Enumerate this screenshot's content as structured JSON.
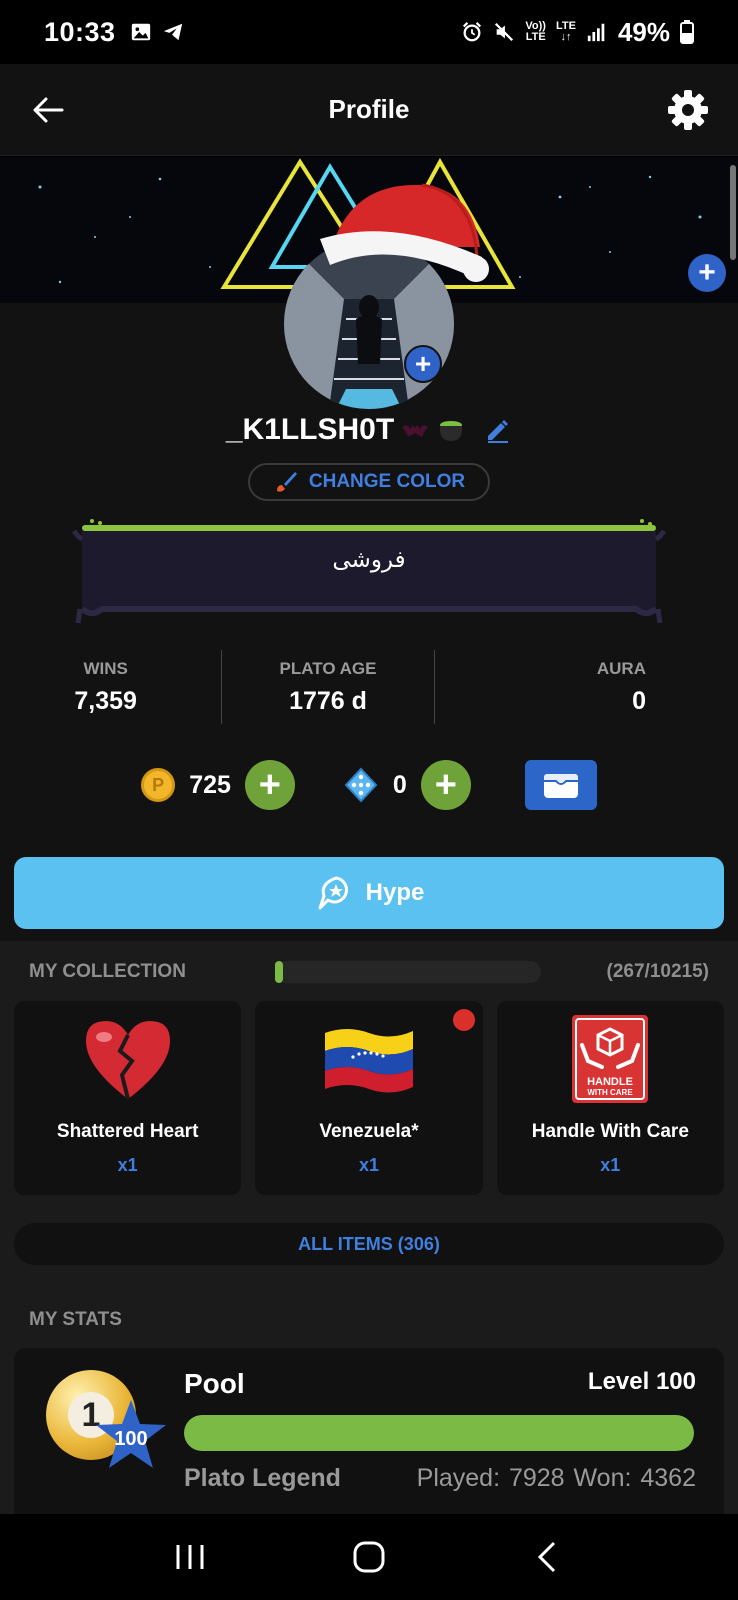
{
  "status_bar": {
    "time": "10:33",
    "battery": "49%",
    "volte": "Vo))\nLTE",
    "lte": "LTE",
    "icons": [
      "gallery-icon",
      "telegram-icon",
      "alarm-icon",
      "mute-icon",
      "volte-icon",
      "lte-icon",
      "signal-icon",
      "battery-icon"
    ]
  },
  "header": {
    "title": "Profile",
    "back_icon": "arrow-left-icon",
    "settings_icon": "gear-icon"
  },
  "profile": {
    "username": "_K1LLSH0T",
    "change_color_label": "CHANGE COLOR",
    "bio": "فروشی"
  },
  "stats": [
    {
      "label": "WINS",
      "value": "7,359"
    },
    {
      "label": "PLATO AGE",
      "value": "1776 d"
    },
    {
      "label": "AURA",
      "value": "0"
    }
  ],
  "currency": {
    "coins": "725",
    "gems": "0"
  },
  "hype_label": "Hype",
  "collection": {
    "title": "MY COLLECTION",
    "count": "(267/10215)",
    "progress_fraction": 0.026,
    "items": [
      {
        "name": "Shattered Heart",
        "qty": "x1",
        "icon": "broken-heart-icon"
      },
      {
        "name": "Venezuela*",
        "qty": "x1",
        "icon": "venezuela-flag-icon",
        "new": true
      },
      {
        "name": "Handle With Care",
        "qty": "x1",
        "icon": "handle-with-care-icon",
        "badge_line1": "HANDLE",
        "badge_line2": "WITH CARE"
      }
    ],
    "all_items_label": "ALL ITEMS (306)"
  },
  "my_stats": {
    "title": "MY STATS",
    "pool": {
      "name": "Pool",
      "level": "Level 100",
      "badge": "100",
      "ball_number": "1",
      "progress_fraction": 1.0,
      "rank_title": "Plato Legend",
      "played_won": "Played: 7928  Won: 4362"
    }
  },
  "colors": {
    "accent_blue": "#2f63c7",
    "hype": "#5bc1f1",
    "green": "#7bbb45",
    "background": "#121212"
  }
}
